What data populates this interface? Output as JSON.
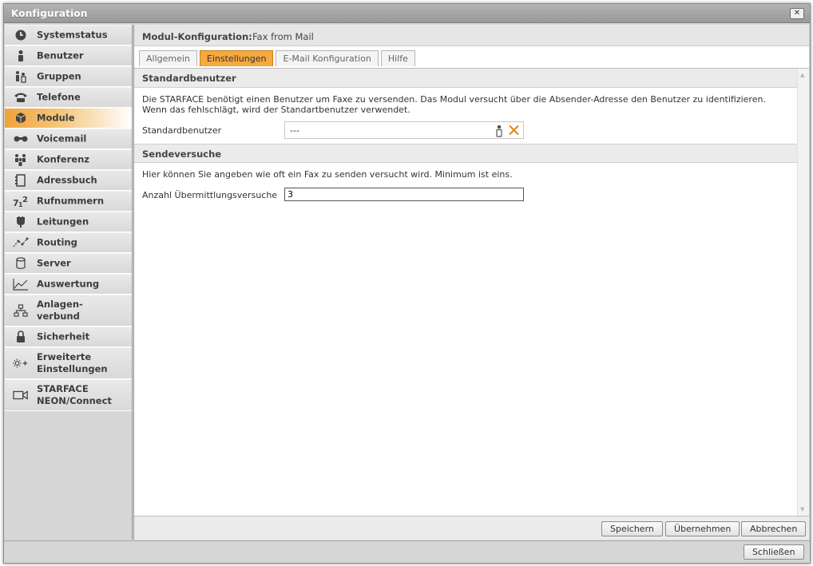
{
  "window": {
    "title": "Konfiguration",
    "close_glyph": "✕",
    "footer_close": "Schließen"
  },
  "sidebar": {
    "items": [
      {
        "label": "Systemstatus",
        "icon": "clock-icon"
      },
      {
        "label": "Benutzer",
        "icon": "user-icon"
      },
      {
        "label": "Gruppen",
        "icon": "group-icon"
      },
      {
        "label": "Telefone",
        "icon": "phone-icon"
      },
      {
        "label": "Module",
        "icon": "cube-icon",
        "active": true
      },
      {
        "label": "Voicemail",
        "icon": "voicemail-icon"
      },
      {
        "label": "Konferenz",
        "icon": "conference-icon"
      },
      {
        "label": "Adressbuch",
        "icon": "addressbook-icon"
      },
      {
        "label": "Rufnummern",
        "icon": "numbers-icon"
      },
      {
        "label": "Leitungen",
        "icon": "lines-icon"
      },
      {
        "label": "Routing",
        "icon": "routing-icon"
      },
      {
        "label": "Server",
        "icon": "server-icon"
      },
      {
        "label": "Auswertung",
        "icon": "chart-icon"
      },
      {
        "label": "Anlagen-\nverbund",
        "icon": "network-icon"
      },
      {
        "label": "Sicherheit",
        "icon": "lock-icon"
      },
      {
        "label": "Erweiterte\nEinstellungen",
        "icon": "advanced-settings-icon"
      },
      {
        "label": "STARFACE\nNEON/Connect",
        "icon": "video-icon"
      }
    ]
  },
  "module": {
    "label": "Modul-Konfiguration:",
    "name": "Fax from Mail"
  },
  "tabs": [
    {
      "label": "Allgemein"
    },
    {
      "label": "Einstellungen",
      "active": true
    },
    {
      "label": "E-Mail Konfiguration"
    },
    {
      "label": "Hilfe"
    }
  ],
  "sections": {
    "standard": {
      "title": "Standardbenutzer",
      "description": "Die STARFACE benötigt einen Benutzer um Faxe zu versenden. Das Modul versucht über die Absender-Adresse den Benutzer zu identifizieren.",
      "description2": "Wenn das fehlschlägt, wird der Standartbenutzer verwendet.",
      "field_label": "Standardbenutzer",
      "field_value": "---"
    },
    "attempts": {
      "title": "Sendeversuche",
      "description": "Hier können Sie angeben wie oft ein Fax zu senden versucht wird. Minimum ist eins.",
      "field_label": "Anzahl Übermittlungsversuche",
      "field_value": "3"
    }
  },
  "buttons": {
    "save": "Speichern",
    "apply": "Übernehmen",
    "cancel": "Abbrechen"
  },
  "colors": {
    "accent": "#f5a93f",
    "active_nav": "#f0a33a",
    "clear_x": "#e8850c"
  }
}
